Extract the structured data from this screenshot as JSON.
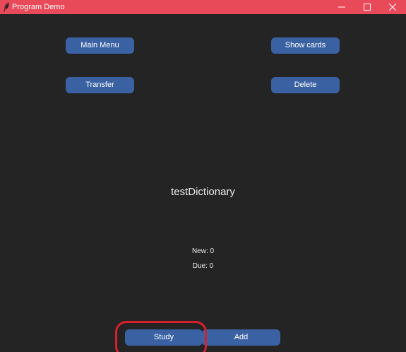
{
  "window": {
    "title": "Program Demo",
    "icons": {
      "app": "feather-icon",
      "minimize": "minimize-icon",
      "maximize": "maximize-icon",
      "close": "close-icon"
    },
    "colors": {
      "titlebar": "#e84a5a",
      "background": "#242424",
      "button": "#3a62a3",
      "highlight": "#d7202c"
    }
  },
  "toolbar": {
    "main_menu_label": "Main Menu",
    "show_cards_label": "Show cards",
    "transfer_label": "Transfer",
    "delete_label": "Delete"
  },
  "deck": {
    "name": "testDictionary",
    "new_text": "New: 0",
    "due_text": "Due: 0"
  },
  "actions": {
    "study_label": "Study",
    "add_label": "Add"
  }
}
